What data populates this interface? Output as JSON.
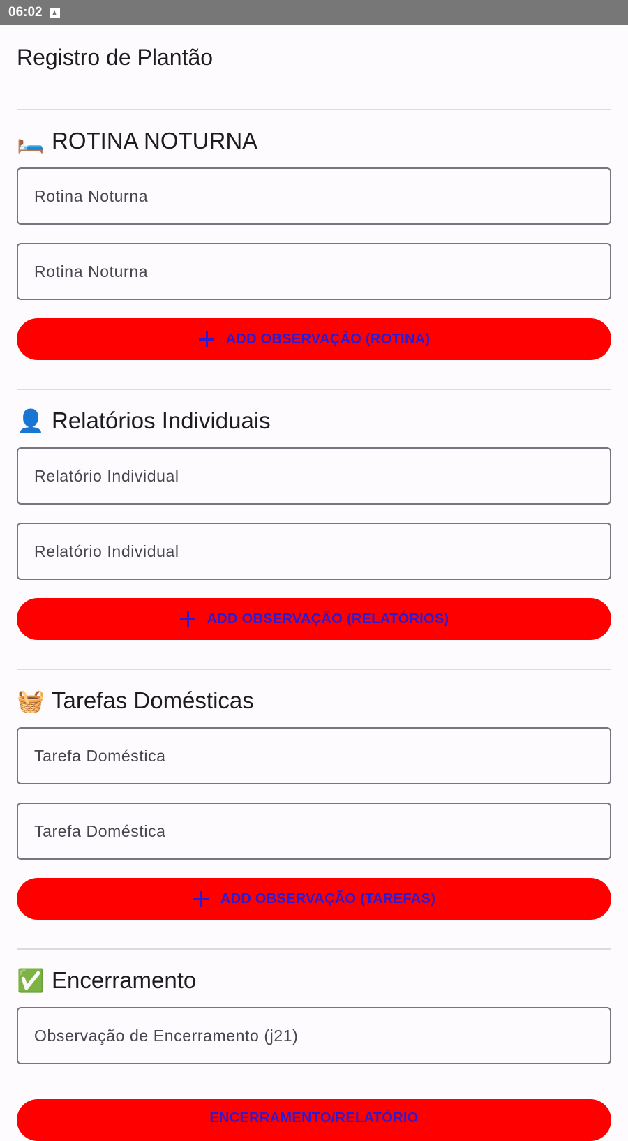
{
  "status_bar": {
    "time": "06:02"
  },
  "page_title": "Registro de Plantão",
  "sections": [
    {
      "emoji": "🛏️",
      "title": "ROTINA NOTURNA",
      "fields": [
        "Rotina Noturna",
        "Rotina Noturna"
      ],
      "button_label": "ADD OBSERVAÇÃO (ROTINA)"
    },
    {
      "emoji": "👤",
      "title": "Relatórios Individuais",
      "fields": [
        "Relatório Individual",
        "Relatório Individual"
      ],
      "button_label": "ADD OBSERVAÇÃO (RELATÓRIOS)"
    },
    {
      "emoji": "🧺",
      "title": "Tarefas Domésticas",
      "fields": [
        "Tarefa Doméstica",
        "Tarefa Doméstica"
      ],
      "button_label": "ADD OBSERVAÇÃO (TAREFAS)"
    },
    {
      "emoji": "✅",
      "title": "Encerramento",
      "fields": [
        "Observação de Encerramento (j21)"
      ],
      "button_label": "ENCERRAMENTO/RELATÓRIO"
    }
  ],
  "colors": {
    "button_bg": "#ff0000",
    "button_text": "#2a1bd6",
    "status_bar": "#777777"
  }
}
